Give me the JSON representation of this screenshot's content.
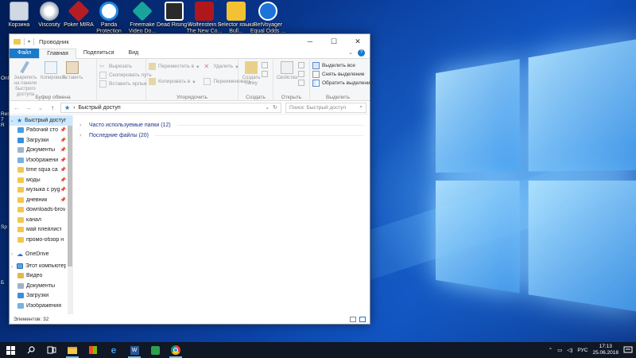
{
  "desktop": {
    "icons": [
      {
        "name": "recycle-bin-icon",
        "label": "Корзина",
        "color": "#cfd8e3"
      },
      {
        "name": "viscosity-icon",
        "label": "Viscosity",
        "color": "#d9dde3"
      },
      {
        "name": "poker-mira-icon",
        "label": "Poker MIRA",
        "color": "#b51d24"
      },
      {
        "name": "panda-protection-icon",
        "label": "Panda Protection",
        "color": "#1e88e5"
      },
      {
        "name": "freemake-video-icon",
        "label": "Freemake Video Do...",
        "color": "#1aa39a"
      },
      {
        "name": "dead-rising-icon",
        "label": "Dead Rising 4",
        "color": "#2a2a2a"
      },
      {
        "name": "wolfenstein-icon",
        "label": "Wolfenstein II The New Co...",
        "color": "#b0171c"
      },
      {
        "name": "selector-icon",
        "label": "Selector языка Bull...",
        "color": "#f2c233"
      },
      {
        "name": "betvoyager-icon",
        "label": "BetVoyager Equal Odds ...",
        "color": "#1e73d8"
      }
    ],
    "edge_labels": [
      "Onl",
      "Res 7 R",
      "Sp",
      "Б"
    ]
  },
  "explorer": {
    "title": "Проводник",
    "tabs": {
      "file": "Файл",
      "home": "Главная",
      "share": "Поделиться",
      "view": "Вид"
    },
    "ribbon": {
      "clipboard": {
        "name": "Буфер обмена",
        "pin": "Закрепить на панели быстрого доступа",
        "copy": "Копировать",
        "paste": "Вставить",
        "cut": "Вырезать",
        "copy_path": "Скопировать путь",
        "paste_shortcut": "Вставить ярлык"
      },
      "organize": {
        "name": "Упорядочить",
        "move_to": "Переместить в",
        "copy_to": "Копировать в",
        "delete": "Удалить",
        "rename": "Переименовать"
      },
      "new": {
        "name": "Создать",
        "new_folder": "Создать папку"
      },
      "open": {
        "name": "Открыть",
        "properties": "Свойства"
      },
      "select": {
        "name": "Выделить",
        "select_all": "Выделить все",
        "select_none": "Снять выделение",
        "invert": "Обратить выделение"
      }
    },
    "address": "Быстрый доступ",
    "search_placeholder": "Поиск: Быстрый доступ",
    "nav": {
      "quick_access": "Быстрый доступ",
      "pinned": [
        "Рабочий сто",
        "Загрузки",
        "Документы",
        "Изображени",
        "time squa ca",
        "моды",
        "музыка с руg",
        "дневник"
      ],
      "recent": [
        "downloads-brov",
        "канал",
        "май плейлист",
        "промо-обзор н"
      ],
      "onedrive": "OneDrive",
      "this_pc": "Этот компьютер",
      "pc_items": [
        "Видео",
        "Документы",
        "Загрузки",
        "Изображения"
      ]
    },
    "main": {
      "frequent": "Часто используемые папки (12)",
      "recent": "Последние файлы (20)"
    },
    "status": "Элементов: 32"
  },
  "taskbar": {
    "lang": "РУС",
    "time": "17:13",
    "date": "25.06.2018"
  }
}
